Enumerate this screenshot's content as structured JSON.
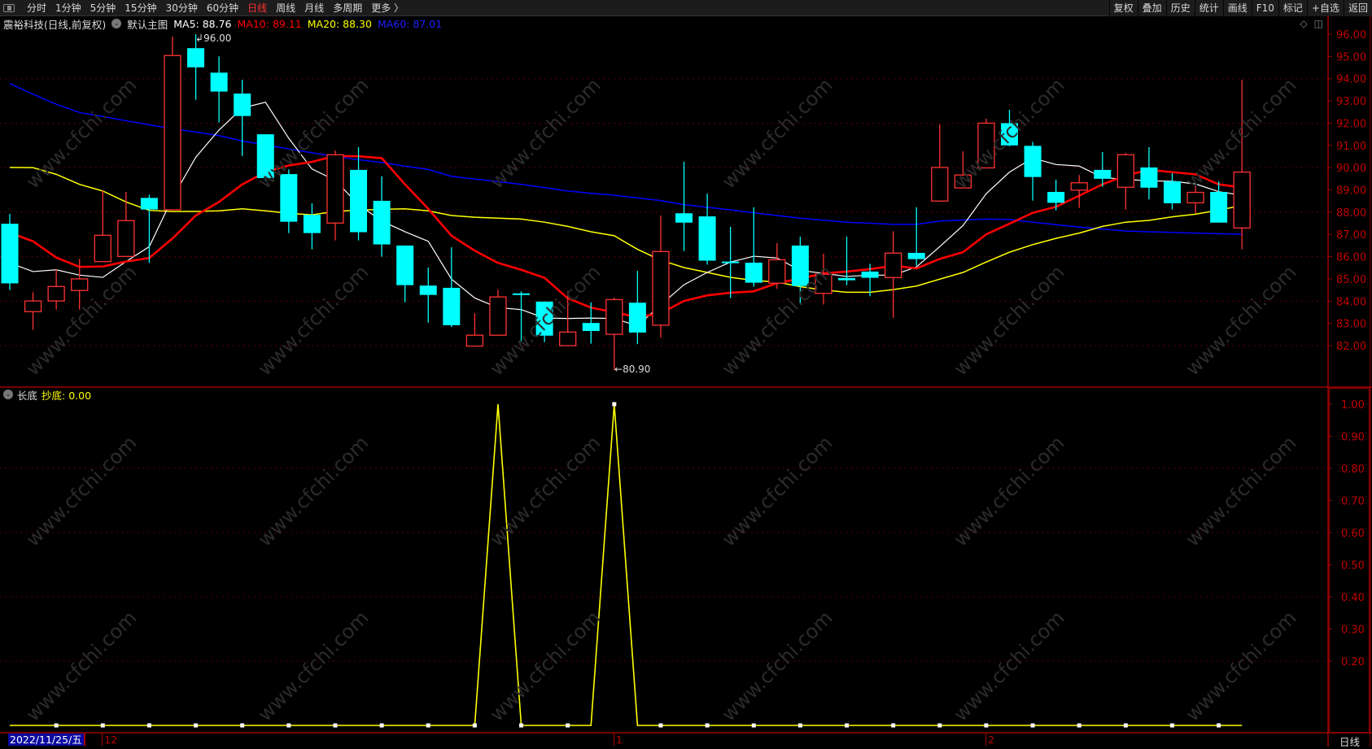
{
  "toolbar": {
    "left_items": [
      "分时",
      "1分钟",
      "5分钟",
      "15分钟",
      "30分钟",
      "60分钟",
      "日线",
      "周线",
      "月线",
      "多周期",
      "更多 〉"
    ],
    "active_index": 6,
    "right_items": [
      "复权",
      "叠加",
      "历史",
      "统计",
      "画线",
      "F10",
      "标记",
      "+自选",
      "返回"
    ]
  },
  "info": {
    "stock": "震裕科技(日线,前复权)",
    "template": "默认主图",
    "ma5": "MA5: 88.76",
    "ma10": "MA10: 89.11",
    "ma20": "MA20: 88.30",
    "ma60": "MA60: 87.01"
  },
  "lower": {
    "name": "长底",
    "indicator": "抄底: 0.00"
  },
  "annotations": {
    "high": "96.00",
    "low": "80.90"
  },
  "x_axis": {
    "date": "2022/11/25/五",
    "labels": [
      {
        "text": "12",
        "index": 4
      },
      {
        "text": "1",
        "index": 26
      },
      {
        "text": "2",
        "index": 42
      }
    ]
  },
  "period_label": "日线",
  "watermark": "www.cfchi.com",
  "colors": {
    "up": "#ff3232",
    "down": "#00ffff",
    "ma5": "#ffffff",
    "ma10": "#ff0000",
    "ma20": "#ffff00",
    "ma60": "#0000ff",
    "axis": "#c00000",
    "signal": "#ffff00"
  },
  "chart_data": [
    {
      "type": "candlestick",
      "title": "震裕科技(日线,前复权)",
      "ylim": [
        80.5,
        96.2
      ],
      "yticks": [
        96,
        95,
        94,
        93,
        92,
        91,
        90,
        89,
        88,
        87,
        86,
        85,
        84,
        83,
        82
      ],
      "ytick_labels": [
        "96.00",
        "95.00",
        "94.00",
        "93.00",
        "92.00",
        "91.00",
        "90.00",
        "89.00",
        "88.00",
        "87.00",
        "86.00",
        "85.00",
        "84.00",
        "83.00",
        "82.00"
      ],
      "grid": [
        94,
        92,
        90,
        88,
        86,
        84,
        82
      ],
      "ohlc": [
        [
          87.48,
          87.92,
          84.5,
          84.8
        ],
        [
          83.53,
          84.4,
          82.71,
          84.01
        ],
        [
          84.01,
          85.42,
          83.62,
          84.66
        ],
        [
          84.48,
          85.9,
          83.62,
          85.0
        ],
        [
          85.78,
          88.98,
          85.78,
          86.96
        ],
        [
          86.01,
          88.91,
          86.01,
          87.62
        ],
        [
          88.64,
          88.78,
          85.72,
          88.12
        ],
        [
          88.11,
          95.89,
          88.11,
          95.04
        ],
        [
          95.37,
          96.0,
          93.05,
          94.51
        ],
        [
          94.27,
          95.0,
          92.03,
          93.42
        ],
        [
          93.33,
          93.95,
          90.53,
          92.32
        ],
        [
          91.5,
          91.5,
          89.4,
          89.53
        ],
        [
          89.71,
          89.92,
          87.06,
          87.57
        ],
        [
          87.88,
          88.4,
          86.33,
          87.06
        ],
        [
          87.51,
          90.77,
          86.73,
          90.58
        ],
        [
          89.9,
          90.92,
          86.73,
          87.1
        ],
        [
          88.51,
          89.61,
          86.0,
          86.55
        ],
        [
          86.5,
          86.5,
          83.95,
          84.72
        ],
        [
          84.7,
          85.51,
          83.04,
          84.28
        ],
        [
          84.6,
          86.42,
          82.84,
          82.92
        ],
        [
          81.98,
          83.46,
          81.98,
          82.47
        ],
        [
          82.47,
          84.52,
          82.47,
          84.19
        ],
        [
          84.35,
          84.44,
          82.21,
          84.3
        ],
        [
          83.98,
          83.98,
          82.16,
          82.45
        ],
        [
          82.0,
          84.44,
          82.0,
          82.61
        ],
        [
          83.02,
          83.95,
          82.09,
          82.66
        ],
        [
          82.51,
          84.16,
          80.9,
          84.07
        ],
        [
          83.93,
          85.36,
          82.07,
          82.59
        ],
        [
          82.92,
          87.85,
          82.36,
          86.23
        ],
        [
          87.95,
          90.27,
          86.25,
          87.53
        ],
        [
          87.81,
          88.83,
          85.64,
          85.82
        ],
        [
          85.78,
          87.34,
          84.14,
          85.74
        ],
        [
          85.73,
          88.22,
          84.65,
          84.83
        ],
        [
          84.81,
          86.61,
          84.56,
          85.86
        ],
        [
          86.5,
          86.9,
          83.91,
          84.68
        ],
        [
          84.35,
          86.13,
          83.85,
          85.21
        ],
        [
          85.04,
          86.9,
          84.72,
          84.94
        ],
        [
          85.33,
          85.68,
          84.22,
          85.05
        ],
        [
          85.06,
          87.14,
          83.25,
          86.16
        ],
        [
          86.17,
          88.22,
          85.6,
          85.89
        ],
        [
          88.5,
          91.95,
          88.5,
          90.01
        ],
        [
          89.09,
          90.73,
          89.09,
          89.67
        ],
        [
          89.99,
          92.2,
          89.99,
          92.0
        ],
        [
          92.0,
          92.6,
          90.96,
          91.0
        ],
        [
          90.98,
          91.16,
          88.52,
          89.58
        ],
        [
          88.91,
          89.46,
          88.08,
          88.42
        ],
        [
          88.99,
          89.67,
          88.19,
          89.32
        ],
        [
          89.9,
          90.7,
          89.15,
          89.5
        ],
        [
          89.12,
          90.66,
          88.11,
          90.58
        ],
        [
          90.01,
          90.92,
          88.58,
          89.1
        ],
        [
          89.39,
          89.75,
          88.12,
          88.4
        ],
        [
          88.42,
          89.17,
          87.95,
          88.89
        ],
        [
          88.91,
          89.38,
          87.53,
          87.53
        ],
        [
          87.29,
          93.95,
          86.33,
          89.8
        ]
      ],
      "ma5": [
        85.72,
        85.33,
        85.41,
        85.17,
        85.07,
        85.78,
        86.45,
        88.64,
        90.47,
        91.69,
        92.68,
        92.94,
        91.32,
        89.94,
        89.43,
        88.34,
        87.6,
        87.12,
        86.69,
        84.99,
        84.14,
        83.71,
        83.62,
        83.24,
        83.22,
        83.24,
        83.22,
        82.89,
        83.83,
        84.74,
        85.29,
        85.76,
        86.02,
        85.94,
        85.38,
        85.25,
        85.11,
        85.17,
        85.17,
        85.54,
        86.45,
        87.4,
        88.83,
        89.8,
        90.43,
        90.14,
        90.07,
        89.56,
        89.47,
        89.41,
        89.39,
        89.27,
        88.92,
        88.76
      ],
      "ma10": [
        87.08,
        86.69,
        85.96,
        85.54,
        85.56,
        85.78,
        85.94,
        86.82,
        87.85,
        88.46,
        89.25,
        89.8,
        90.1,
        90.26,
        90.53,
        90.51,
        90.43,
        89.25,
        88.15,
        86.94,
        86.27,
        85.72,
        85.41,
        85.05,
        84.13,
        83.71,
        83.5,
        83.28,
        83.46,
        84.01,
        84.26,
        84.38,
        84.44,
        84.81,
        85.01,
        85.25,
        85.33,
        85.44,
        85.59,
        85.47,
        85.9,
        86.2,
        87.0,
        87.48,
        87.97,
        88.24,
        88.74,
        89.25,
        89.65,
        89.9,
        89.8,
        89.7,
        89.25,
        89.11
      ],
      "ma20": [
        90.01,
        90.0,
        89.7,
        89.25,
        88.95,
        88.46,
        88.08,
        88.03,
        88.03,
        88.06,
        88.15,
        88.06,
        87.95,
        87.88,
        88.03,
        88.09,
        88.13,
        88.15,
        88.06,
        87.85,
        87.77,
        87.73,
        87.69,
        87.55,
        87.36,
        87.12,
        86.94,
        86.33,
        85.84,
        85.51,
        85.29,
        85.07,
        84.93,
        84.86,
        84.65,
        84.5,
        84.4,
        84.4,
        84.52,
        84.68,
        84.99,
        85.29,
        85.76,
        86.2,
        86.54,
        86.82,
        87.06,
        87.36,
        87.55,
        87.63,
        87.79,
        87.91,
        88.09,
        88.3
      ],
      "ma60": [
        93.78,
        93.3,
        92.85,
        92.48,
        92.3,
        92.11,
        91.93,
        91.75,
        91.6,
        91.44,
        91.2,
        91.02,
        90.84,
        90.67,
        90.5,
        90.36,
        90.23,
        90.07,
        89.92,
        89.61,
        89.49,
        89.37,
        89.25,
        89.1,
        88.95,
        88.85,
        88.76,
        88.64,
        88.52,
        88.34,
        88.22,
        88.1,
        87.97,
        87.85,
        87.73,
        87.64,
        87.55,
        87.5,
        87.45,
        87.45,
        87.6,
        87.65,
        87.69,
        87.67,
        87.55,
        87.44,
        87.33,
        87.24,
        87.15,
        87.12,
        87.09,
        87.06,
        87.03,
        87.01
      ]
    },
    {
      "type": "line",
      "title": "长底",
      "series_name": "抄底",
      "ylim": [
        0,
        1
      ],
      "yticks": [
        1.0,
        0.9,
        0.8,
        0.7,
        0.6,
        0.5,
        0.4,
        0.3,
        0.2
      ],
      "ytick_labels": [
        "1.00",
        "0.90",
        "0.80",
        "0.70",
        "0.60",
        "0.50",
        "0.40",
        "0.30",
        "0.20"
      ],
      "grid": [
        0.8,
        0.6,
        0.4,
        0.2
      ],
      "values": [
        0,
        0,
        0,
        0,
        0,
        0,
        0,
        0,
        0,
        0,
        0,
        0,
        0,
        0,
        0,
        0,
        0,
        0,
        0,
        0,
        0,
        1,
        0,
        0,
        0,
        0,
        1,
        0,
        0,
        0,
        0,
        0,
        0,
        0,
        0,
        0,
        0,
        0,
        0,
        0,
        0,
        0,
        0,
        0,
        0,
        0,
        0,
        0,
        0,
        0,
        0,
        0,
        0,
        0
      ]
    }
  ]
}
